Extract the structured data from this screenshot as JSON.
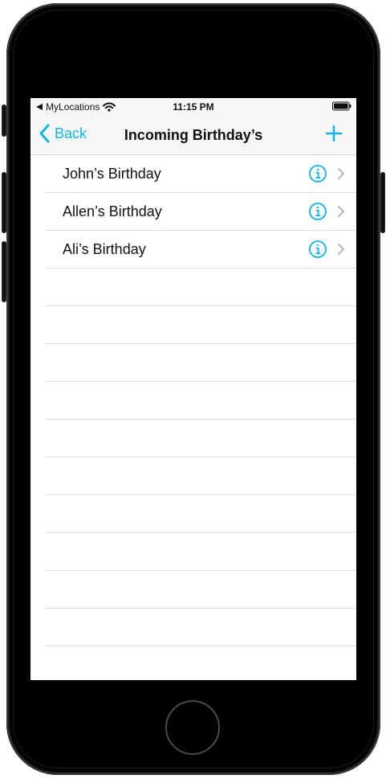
{
  "status_bar": {
    "carrier": "MyLocations",
    "time": "11:15 PM"
  },
  "nav": {
    "back_label": "Back",
    "title": "Incoming Birthday’s"
  },
  "list": {
    "rows": [
      {
        "label": "John’s Birthday"
      },
      {
        "label": "Allen’s Birthday"
      },
      {
        "label": "Ali’s Birthday"
      }
    ]
  },
  "theme": {
    "accent": "#10b4e6",
    "separator": "#dcdcdc",
    "device_frame": "#000000"
  },
  "icons": {
    "back_arrow": "back-arrow-icon",
    "wifi": "wifi-icon",
    "battery": "battery-icon",
    "back_chevron": "chevron-left-icon",
    "add": "plus-icon",
    "info": "info-icon",
    "disclosure": "chevron-right-icon"
  }
}
